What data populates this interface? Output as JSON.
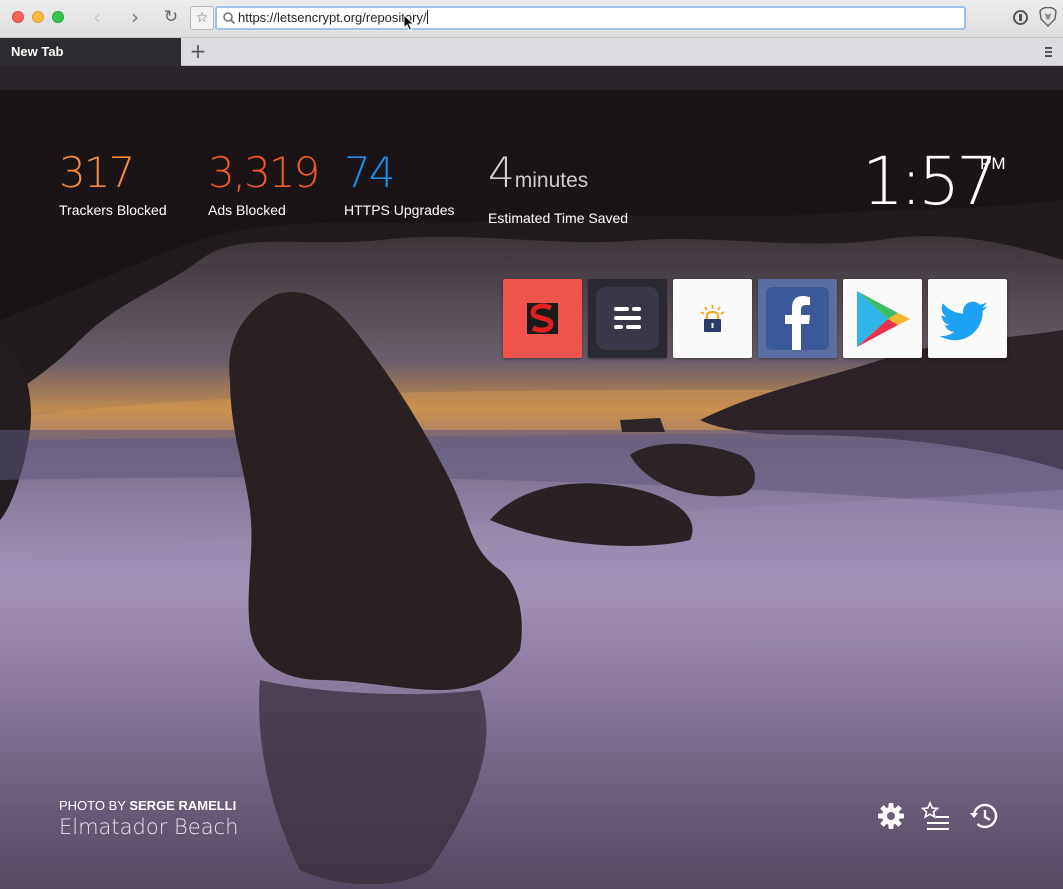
{
  "browser": {
    "url": "https://letsencrypt.org/repository/",
    "tab_title": "New Tab",
    "new_tab_symbol": "+",
    "back_symbol": "‹",
    "forward_symbol": "›",
    "reload_symbol": "↻",
    "bookmark_symbol": "☆"
  },
  "stats": [
    {
      "value": "317",
      "label": "Trackers Blocked",
      "color": "#f48a3a"
    },
    {
      "value": "3,319",
      "label": "Ads Blocked",
      "color": "#ef5a2b"
    },
    {
      "value": "74",
      "label": "HTTPS Upgrades",
      "color": "#1e8fe8"
    },
    {
      "value": "4",
      "unit": "minutes",
      "label": "Estimated Time Saved",
      "color": "#cfcfcf"
    }
  ],
  "clock": {
    "time": "1:57",
    "ampm": "PM"
  },
  "top_sites": [
    {
      "name": "site-s-red",
      "icon": "s-logo-icon",
      "bg": "#f0544a"
    },
    {
      "name": "site-dark-menu",
      "icon": "bars-logo-icon",
      "bg": "#2f2d3a"
    },
    {
      "name": "site-letsencrypt",
      "icon": "letsencrypt-lock-icon",
      "bg": "#ffffff"
    },
    {
      "name": "site-facebook",
      "icon": "facebook-icon",
      "bg": "#3b5998"
    },
    {
      "name": "site-google-play",
      "icon": "google-play-icon",
      "bg": "#ffffff"
    },
    {
      "name": "site-twitter",
      "icon": "twitter-icon",
      "bg": "#ffffff"
    }
  ],
  "credit": {
    "prefix": "PHOTO BY",
    "photographer": "SERGE RAMELLI",
    "location": "Elmatador Beach"
  },
  "footer_icons": [
    "settings-gear-icon",
    "bookmarks-icon",
    "history-icon"
  ]
}
